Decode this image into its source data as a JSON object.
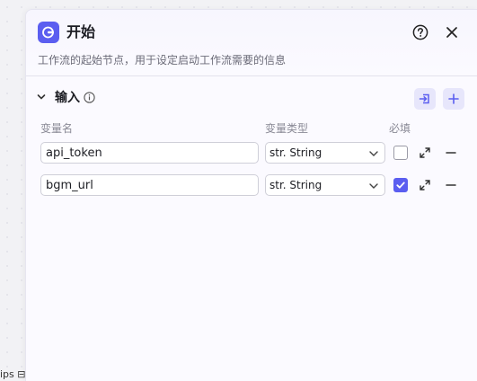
{
  "canvas": {
    "snippet_text": "ips ⊟"
  },
  "panel": {
    "title": "开始",
    "description": "工作流的起始节点，用于设定启动工作流需要的信息",
    "icons": {
      "node": "start-node-icon",
      "help": "help-icon",
      "close": "close-icon"
    }
  },
  "input_section": {
    "title": "输入",
    "columns": {
      "name": "变量名",
      "type": "变量类型",
      "required": "必填"
    },
    "rows": [
      {
        "name": "api_token",
        "type": "str. String",
        "required": false
      },
      {
        "name": "bgm_url",
        "type": "str. String",
        "required": true
      }
    ]
  },
  "colors": {
    "accent": "#5b5ef0",
    "accent_light": "#e7e6fb"
  }
}
